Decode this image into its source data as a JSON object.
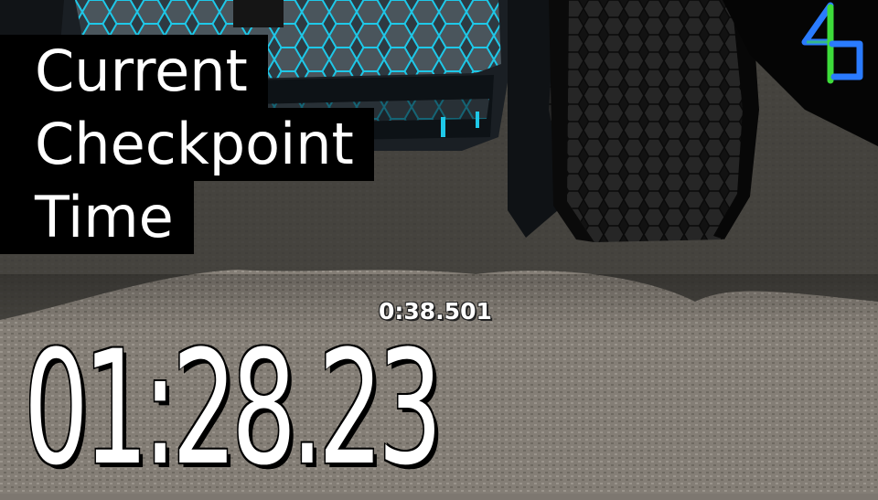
{
  "overlay": {
    "title_lines": [
      "Current",
      "Checkpoint",
      "Time"
    ]
  },
  "hud": {
    "checkpoint_time": "0:38.501",
    "race_time": "01:28.23"
  },
  "icons": {
    "logo": "4b-logo-icon"
  },
  "colors": {
    "neon_accent": "#1ec8e8",
    "logo_blue": "#2a7bff",
    "logo_green": "#3ddc3a",
    "track": "#7d7770"
  }
}
